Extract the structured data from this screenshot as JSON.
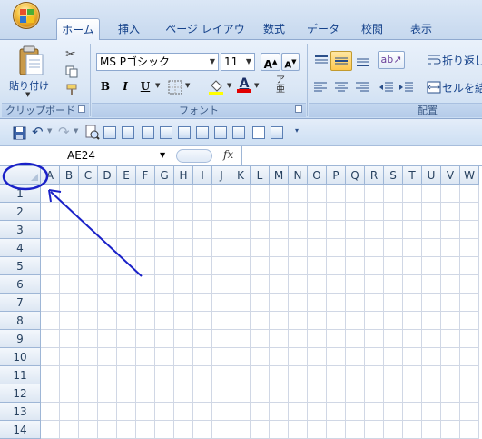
{
  "tabs": [
    "ホーム",
    "挿入",
    "ページ レイアウト",
    "数式",
    "データ",
    "校閲",
    "表示"
  ],
  "active_tab": "ホーム",
  "ribbon": {
    "clipboard": {
      "paste_label": "貼り付け",
      "group_label": "クリップボード"
    },
    "font": {
      "font_name": "MS Pゴシック",
      "font_size": "11",
      "bold": "B",
      "italic": "I",
      "underline": "U",
      "group_label": "フォント"
    },
    "alignment": {
      "wrap_label": "折り返し",
      "merge_label": "セルを結",
      "group_label": "配置"
    }
  },
  "name_box": "AE24",
  "formula_icon": "fx",
  "columns": [
    "A",
    "B",
    "C",
    "D",
    "E",
    "F",
    "G",
    "H",
    "I",
    "J",
    "K",
    "L",
    "M",
    "N",
    "O",
    "P",
    "Q",
    "R",
    "S",
    "T",
    "U",
    "V",
    "W"
  ],
  "rows": [
    "1",
    "2",
    "3",
    "4",
    "5",
    "6",
    "7",
    "8",
    "9",
    "10",
    "11",
    "12",
    "13",
    "14"
  ],
  "annotation": {
    "color": "#1a21c8",
    "shape": "ellipse-with-arrow",
    "target": "select-all-corner"
  },
  "colors": {
    "accent": "#1a21c8",
    "ribbon_bg": "#dbe7f5",
    "header_bg": "#dde7f3",
    "gridline": "#d0d7e5"
  }
}
